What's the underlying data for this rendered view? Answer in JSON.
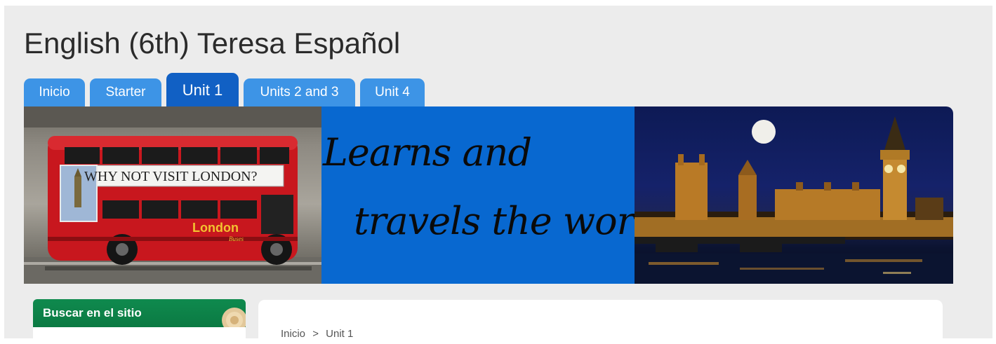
{
  "site": {
    "title": "English (6th) Teresa Español"
  },
  "tabs": [
    {
      "label": "Inicio",
      "active": false
    },
    {
      "label": "Starter",
      "active": false
    },
    {
      "label": "Unit 1",
      "active": true
    },
    {
      "label": "Units 2 and 3",
      "active": false
    },
    {
      "label": "Unit 4",
      "active": false
    }
  ],
  "banner": {
    "bus_sign": "WHY NOT VISIT LONDON?",
    "bus_logo": "London",
    "bus_logo_sub": "Buses",
    "slogan_line1": "Learns and",
    "slogan_line2": "travels  the world",
    "colors": {
      "blue_panel": "#0868d0",
      "bus_red": "#c8171e"
    }
  },
  "sidebar": {
    "search_block_title": "Buscar en el sitio"
  },
  "breadcrumb": {
    "home": "Inicio",
    "separator": ">",
    "current": "Unit 1"
  },
  "colors": {
    "tab": "#3d94e6",
    "tab_active": "#1160c4",
    "sidebar_header": "#0f8a4e"
  }
}
